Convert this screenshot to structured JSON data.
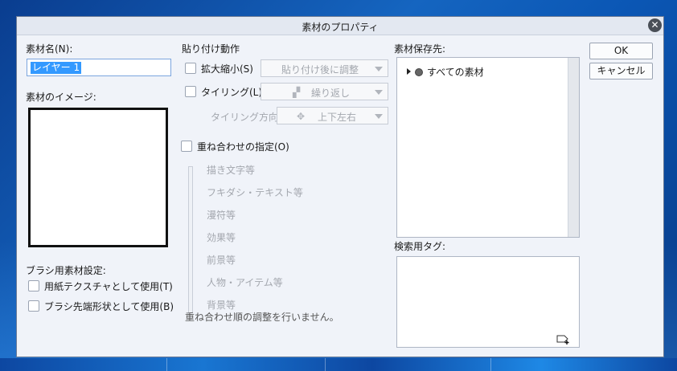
{
  "dialog": {
    "title": "素材のプロパティ",
    "close_symbol": "✕"
  },
  "left": {
    "name_label": "素材名(N):",
    "name_value": "レイヤー 1",
    "image_label": "素材のイメージ:",
    "brush_settings_label": "ブラシ用素材設定:",
    "use_as_paper_texture": "用紙テクスチャとして使用(T)",
    "use_as_brush_tip": "ブラシ先端形状として使用(B)"
  },
  "paste": {
    "section_label": "貼り付け動作",
    "scale_checkbox": "拡大縮小(S)",
    "scale_dropdown": "貼り付け後に調整",
    "tiling_checkbox": "タイリング(L)",
    "tiling_dropdown": "繰り返し",
    "tiling_direction_label": "タイリング方向:",
    "tiling_direction_dropdown": "上下左右",
    "overlay_checkbox": "重ね合わせの指定(O)",
    "overlay_items": [
      "描き文字等",
      "フキダシ・テキスト等",
      "漫符等",
      "効果等",
      "前景等",
      "人物・アイテム等",
      "背景等"
    ],
    "overlay_note": "重ね合わせ順の調整を行いません。"
  },
  "save": {
    "location_label": "素材保存先:",
    "tree_item": "すべての素材",
    "search_tag_label": "検索用タグ:"
  },
  "buttons": {
    "ok": "OK",
    "cancel": "キャンセル"
  },
  "colors": {
    "selection": "#3399ff",
    "dialog_bg": "#f0f3f9"
  }
}
